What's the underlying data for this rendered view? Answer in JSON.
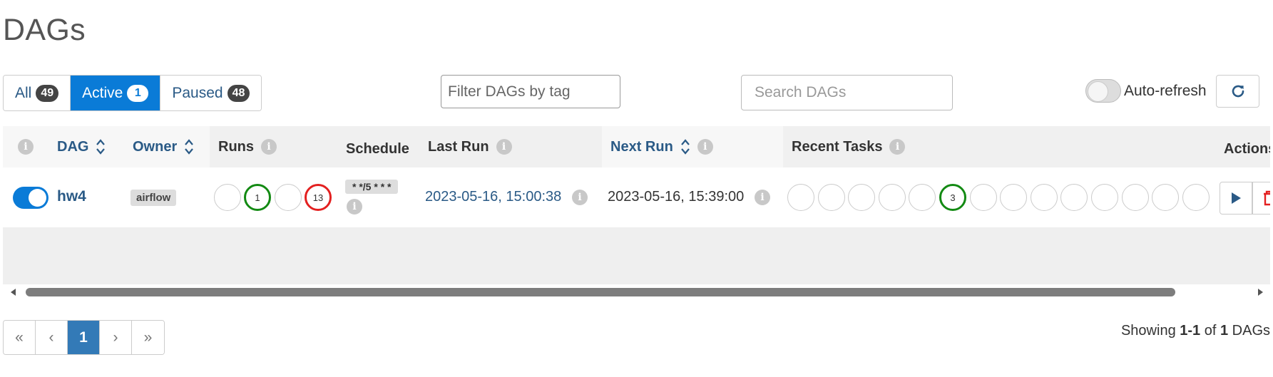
{
  "page": {
    "title": "DAGs"
  },
  "status_tabs": [
    {
      "label": "All",
      "count": "49",
      "active": false
    },
    {
      "label": "Active",
      "count": "1",
      "active": true
    },
    {
      "label": "Paused",
      "count": "48",
      "active": false
    }
  ],
  "filters": {
    "tag_placeholder": "Filter DAGs by tag",
    "search_placeholder": "Search DAGs"
  },
  "auto_refresh": {
    "label": "Auto-refresh",
    "enabled": false
  },
  "table": {
    "headers": {
      "dag": "DAG",
      "owner": "Owner",
      "runs": "Runs",
      "schedule": "Schedule",
      "last_run": "Last Run",
      "next_run": "Next Run",
      "recent_tasks": "Recent Tasks",
      "actions": "Actions"
    },
    "rows": [
      {
        "active": true,
        "dag_id": "hw4",
        "owner": "airflow",
        "runs": [
          "",
          "1",
          "",
          "13"
        ],
        "run_states": [
          "none",
          "success",
          "none",
          "failed"
        ],
        "schedule": "* */5 * * *",
        "last_run": "2023-05-16, 15:00:38",
        "next_run": "2023-05-16, 15:39:00",
        "recent_tasks": [
          "",
          "",
          "",
          "",
          "",
          "3",
          "",
          "",
          "",
          "",
          "",
          "",
          "",
          ""
        ],
        "recent_task_states": [
          "none",
          "none",
          "none",
          "none",
          "none",
          "success",
          "none",
          "none",
          "none",
          "none",
          "none",
          "none",
          "none",
          "none"
        ]
      }
    ]
  },
  "pagination": {
    "first": "«",
    "prev": "‹",
    "current": "1",
    "next": "›",
    "last": "»"
  },
  "summary": {
    "prefix": "Showing",
    "range": "1-1",
    "of": "of",
    "total": "1",
    "suffix": "DAGs"
  },
  "colors": {
    "primary": "#0a7bd7",
    "link": "#2a5a86",
    "success": "#138a13",
    "failed": "#e32020",
    "pagination_active": "#337ab7"
  },
  "icons": {
    "refresh": "refresh-icon",
    "sort": "sort-icon",
    "info": "info-icon",
    "trigger": "play-icon",
    "delete": "trash-icon"
  }
}
